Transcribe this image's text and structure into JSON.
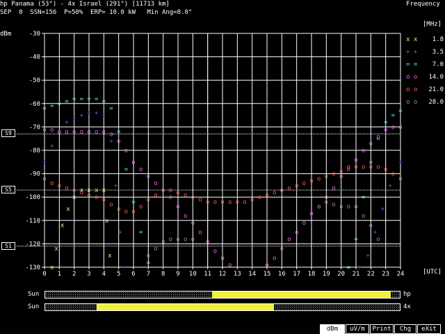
{
  "header": {
    "path_line": "hp Panama (53°) - 4x Israel (291°) [11713 km]",
    "params_line": "SEP  0  SSN=156  P=50%  ERP= 10.0 kW   Min Ang=8.0°",
    "frequency_title": "Frequency",
    "mhz_label": "[MHz]",
    "utc_label": "[UTC]"
  },
  "chart_data": {
    "type": "scatter",
    "ylabel": "dBm",
    "ylim": [
      -130,
      -30
    ],
    "xlim": [
      0,
      24
    ],
    "y_ticks": [
      -30,
      -40,
      -50,
      -60,
      -70,
      -80,
      -90,
      -100,
      -110,
      -120,
      -130
    ],
    "x_ticks": [
      0,
      1,
      2,
      3,
      4,
      5,
      6,
      7,
      8,
      9,
      10,
      11,
      12,
      13,
      14,
      15,
      16,
      17,
      18,
      19,
      20,
      21,
      22,
      23,
      24
    ],
    "grid": true,
    "current_time_marker": 11,
    "s_levels": [
      {
        "label": "S9",
        "value": -73
      },
      {
        "label": "S5",
        "value": -97
      },
      {
        "label": "S1",
        "value": -121
      }
    ],
    "series": [
      {
        "name": "1.8",
        "symbol": "x",
        "color": "#f0f080",
        "x": [
          0.5,
          0.8,
          1.2,
          1.6,
          2.0,
          2.5,
          3.0,
          3.5,
          4.0,
          4.2,
          4.4
        ],
        "y": [
          -130,
          -122,
          -112,
          -105,
          -100,
          -97,
          -97,
          -97,
          -97,
          -110,
          -125
        ]
      },
      {
        "name": "3.5",
        "symbol": "+",
        "color": "#6060ff",
        "x": [
          0,
          0.5,
          1,
          1.5,
          2,
          2.5,
          3,
          3.5,
          4,
          4.5,
          4.8,
          5.1,
          5.4,
          21.2,
          21.8,
          22.3,
          22.8,
          23.3,
          24
        ],
        "y": [
          -85,
          -78,
          -72,
          -68,
          -66,
          -65,
          -64,
          -64,
          -65,
          -76,
          -95,
          -115,
          -130,
          -130,
          -125,
          -115,
          -105,
          -95,
          -85
        ]
      },
      {
        "name": "7.0",
        "symbol": "=",
        "color": "#60f0f0",
        "x": [
          0,
          0.5,
          1,
          1.5,
          2,
          2.5,
          3,
          3.5,
          4,
          4.5,
          5,
          5.5,
          6,
          6.5,
          7,
          20.5,
          21,
          21.5,
          22,
          22.5,
          23,
          23.5,
          24
        ],
        "y": [
          -62,
          -61,
          -60,
          -59,
          -58,
          -58,
          -58,
          -58,
          -59,
          -62,
          -72,
          -88,
          -102,
          -115,
          -128,
          -130,
          -118,
          -100,
          -85,
          -75,
          -68,
          -65,
          -63
        ]
      },
      {
        "name": "14.0",
        "symbol": "o",
        "color": "#f060f0",
        "x": [
          0,
          0.5,
          1,
          1.5,
          2,
          2.5,
          3,
          3.5,
          4,
          4.5,
          5,
          5.5,
          6,
          6.5,
          7,
          7.5,
          8,
          8.5,
          9,
          9.5,
          10,
          10.5,
          11,
          11.5,
          12,
          12.5,
          15,
          15.5,
          16,
          16.5,
          17,
          17.5,
          18,
          18.5,
          19,
          19.5,
          20,
          20.5,
          21,
          21.5,
          22,
          22.5,
          23,
          23.5,
          24
        ],
        "y": [
          -71,
          -71,
          -72,
          -72,
          -72,
          -72,
          -72,
          -72,
          -72,
          -73,
          -76,
          -80,
          -85,
          -88,
          -91,
          -94,
          -97,
          -100,
          -104,
          -108,
          -111,
          -115,
          -119,
          -123,
          -126,
          -129,
          -129,
          -126,
          -122,
          -118,
          -115,
          -111,
          -107,
          -104,
          -100,
          -96,
          -91,
          -87,
          -84,
          -80,
          -77,
          -74,
          -71,
          -70,
          -70
        ]
      },
      {
        "name": "21.0",
        "symbol": "o",
        "color": "#f06050",
        "x": [
          0,
          0.5,
          1,
          1.5,
          2,
          2.5,
          3,
          3.5,
          4,
          4.5,
          5,
          5.5,
          6,
          6.5,
          7,
          7.5,
          8,
          8.5,
          9,
          9.5,
          10,
          10.5,
          11,
          11.5,
          12,
          12.5,
          13,
          13.5,
          14,
          14.5,
          15,
          15.5,
          16,
          16.5,
          17,
          17.5,
          18,
          18.5,
          19,
          19.5,
          20,
          20.5,
          21,
          21.5,
          22,
          22.5,
          23,
          23.5,
          24
        ],
        "y": [
          -92,
          -94,
          -95,
          -96,
          -97,
          -98,
          -99,
          -100,
          -101,
          -103,
          -105,
          -106,
          -106,
          -104,
          -101,
          -99,
          -97,
          -97,
          -98,
          -99,
          -100,
          -101,
          -102,
          -102,
          -102,
          -102,
          -102,
          -102,
          -101,
          -100,
          -99,
          -98,
          -97,
          -96,
          -95,
          -94,
          -93,
          -92,
          -91,
          -90,
          -89,
          -88,
          -87,
          -87,
          -87,
          -87,
          -88,
          -90,
          -92
        ]
      },
      {
        "name": "28.0",
        "symbol": "o",
        "color": "#909090",
        "x": [
          7,
          7.5,
          8,
          8.5,
          9,
          9.5,
          10,
          18.5,
          19,
          19.5,
          20,
          20.5,
          21,
          21.5,
          22,
          22.5
        ],
        "y": [
          -125,
          -122,
          -119,
          -118,
          -118,
          -118,
          -118,
          -104,
          -102,
          -103,
          -104,
          -104,
          -104,
          -108,
          -112,
          -118
        ]
      }
    ]
  },
  "timeline": [
    {
      "day": "Sun",
      "station": "hp",
      "fill_from": 11.3,
      "fill_to": 23.4,
      "fill_color": "#f0f040"
    },
    {
      "day": "Sun",
      "station": "4x",
      "fill_from": 3.5,
      "fill_to": 15.5,
      "fill_color": "#f0f040"
    }
  ],
  "buttons": [
    {
      "label": "dBm",
      "active": true
    },
    {
      "label": "uV/m",
      "active": false
    },
    {
      "label": "Print",
      "active": false
    },
    {
      "label": "Chg",
      "active": false
    },
    {
      "label": "eXit",
      "active": false
    }
  ]
}
